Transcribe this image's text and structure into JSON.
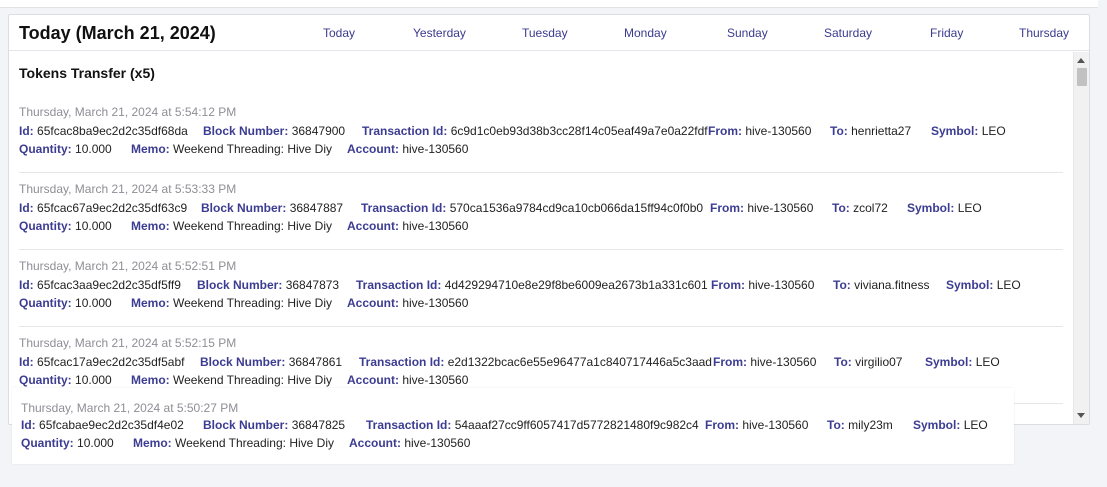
{
  "header": {
    "title": "Today (March 21, 2024)",
    "tabs": [
      "Today",
      "Yesterday",
      "Tuesday",
      "Monday",
      "Sunday",
      "Saturday",
      "Friday",
      "Thursday"
    ]
  },
  "section": {
    "title": "Tokens Transfer (x5)"
  },
  "labels": {
    "id": "Id:",
    "block": "Block Number:",
    "tx": "Transaction Id:",
    "from": "From:",
    "to": "To:",
    "symbol": "Symbol:",
    "quantity": "Quantity:",
    "memo": "Memo:",
    "account": "Account:"
  },
  "entries": [
    {
      "timestamp": "Thursday, March 21, 2024 at 5:54:12 PM",
      "id": "65fcac8ba9ec2d2c35df68da",
      "block": "36847900",
      "tx": "6c9d1c0eb93d38b3cc28f14c05eaf49a7e0a22fdf",
      "from": "hive-130560",
      "to": "henrietta27",
      "symbol": "LEO",
      "quantity": "10.000",
      "memo": "Weekend Threading: Hive Diy",
      "account": "hive-130560"
    },
    {
      "timestamp": "Thursday, March 21, 2024 at 5:53:33 PM",
      "id": "65fcac67a9ec2d2c35df63c9",
      "block": "36847887",
      "tx": "570ca1536a9784cd9ca10cb066da15ff94c0f0b0",
      "from": "hive-130560",
      "to": "zcol72",
      "symbol": "LEO",
      "quantity": "10.000",
      "memo": "Weekend Threading: Hive Diy",
      "account": "hive-130560"
    },
    {
      "timestamp": "Thursday, March 21, 2024 at 5:52:51 PM",
      "id": "65fcac3aa9ec2d2c35df5ff9",
      "block": "36847873",
      "tx": "4d429294710e8e29f8be6009ea2673b1a331c601",
      "from": "hive-130560",
      "to": "viviana.fitness",
      "symbol": "LEO",
      "quantity": "10.000",
      "memo": "Weekend Threading: Hive Diy",
      "account": "hive-130560"
    },
    {
      "timestamp": "Thursday, March 21, 2024 at 5:52:15 PM",
      "id": "65fcac17a9ec2d2c35df5abf",
      "block": "36847861",
      "tx": "e2d1322bcac6e55e96477a1c840717446a5c3aad",
      "from": "hive-130560",
      "to": "virgilio07",
      "symbol": "LEO",
      "quantity": "10.000",
      "memo": "Weekend Threading: Hive Diy",
      "account": "hive-130560"
    },
    {
      "timestamp": "Thursday, March 21, 2024 at 5:50:27 PM",
      "id": "65fcabae9ec2d2c35df4e02",
      "block": "36847825",
      "tx": "54aaaf27cc9ff6057417d5772821480f9c982c4",
      "from": "hive-130560",
      "to": "mily23m",
      "symbol": "LEO",
      "quantity": "10.000",
      "memo": "Weekend Threading: Hive Diy",
      "account": "hive-130560"
    }
  ]
}
